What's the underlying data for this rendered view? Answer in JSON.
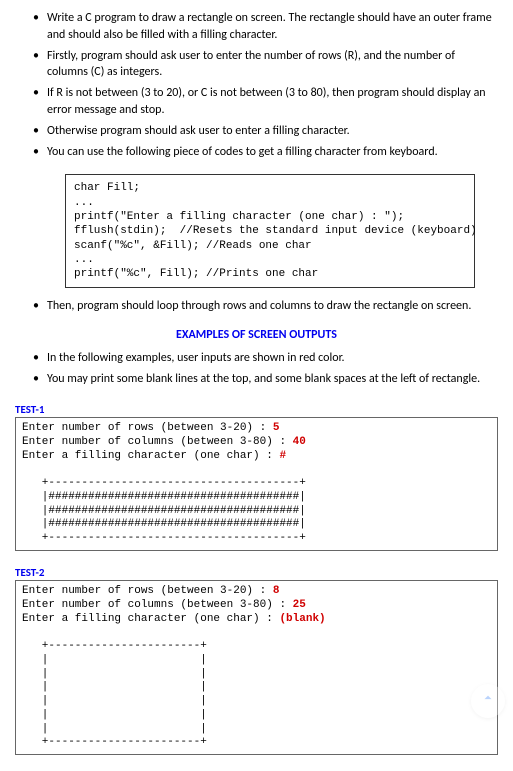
{
  "bullets_top": [
    "Write a C program to draw a rectangle on screen.\nThe rectangle should have an outer frame and should also be filled with a filling character.",
    "Firstly, program should ask user to enter the number of rows (R), and the number of columns (C) as integers.",
    "If R is not between (3 to 20), or  C is not between (3 to 80), then program should display an error message and stop.",
    "Otherwise program should ask user to enter a filling character.",
    "You can use the following piece of codes to get a filling character from keyboard."
  ],
  "code_block": "char Fill;\n...\nprintf(\"Enter a filling character (one char) : \");\nfflush(stdin);  //Resets the standard input device (keyboard)\nscanf(\"%c\", &Fill); //Reads one char\n...\nprintf(\"%c\", Fill); //Prints one char",
  "bullets_mid": [
    "Then, program should loop through rows and columns to draw the rectangle on screen."
  ],
  "examples_header": "EXAMPLES OF SCREEN OUTPUTS",
  "bullets_examples": [
    "In the following examples, user inputs are shown in red color.",
    "You may print some blank lines at the top, and some blank spaces at the left of rectangle."
  ],
  "test1": {
    "label": "TEST-1",
    "prompts": {
      "rows": "Enter number of rows (between 3-20) : ",
      "rows_input": "5",
      "cols": "Enter number of columns (between 3-80) : ",
      "cols_input": "40",
      "fill": "Enter a filling character (one char) : ",
      "fill_input": "#"
    },
    "output": "\n\n   +--------------------------------------+\n   |######################################|\n   |######################################|\n   |######################################|\n   +--------------------------------------+"
  },
  "test2": {
    "label": "TEST-2",
    "prompts": {
      "rows": "Enter number of rows (between 3-20) : ",
      "rows_input": "8",
      "cols": "Enter number of columns (between 3-80) : ",
      "cols_input": "25",
      "fill": "Enter a filling character (one char) : ",
      "fill_input": "(blank)"
    },
    "output": "\n\n   +-----------------------+\n   |                       |\n   |                       |\n   |                       |\n   |                       |\n   |                       |\n   |                       |\n   +-----------------------+"
  }
}
